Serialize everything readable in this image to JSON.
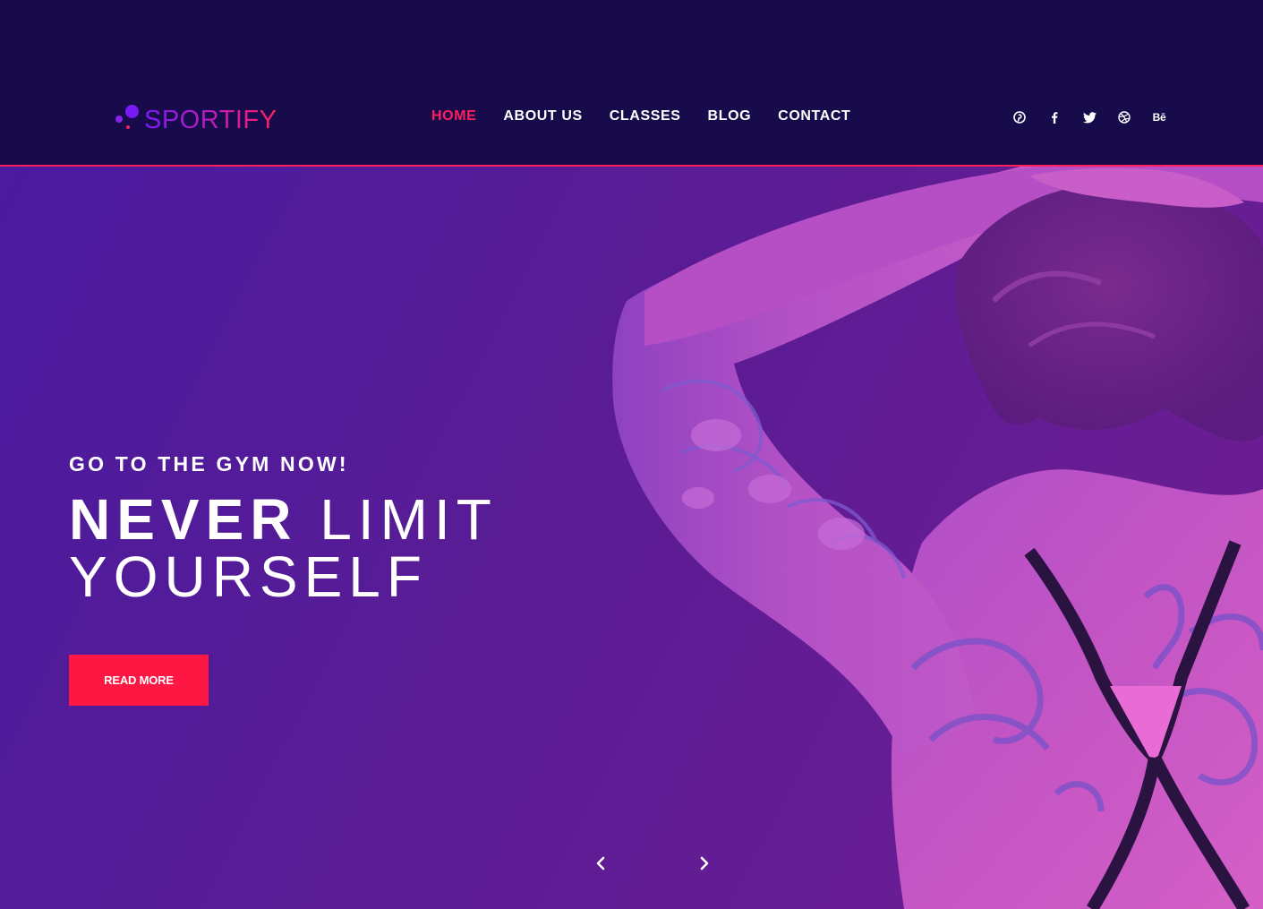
{
  "brand": {
    "name": "SPORTIFY"
  },
  "nav": {
    "items": [
      {
        "label": "HOME",
        "active": true
      },
      {
        "label": "ABOUT US",
        "active": false
      },
      {
        "label": "CLASSES",
        "active": false
      },
      {
        "label": "BLOG",
        "active": false
      },
      {
        "label": "CONTACT",
        "active": false
      }
    ]
  },
  "social": {
    "icons": [
      "pinterest-icon",
      "facebook-icon",
      "twitter-icon",
      "dribbble-icon",
      "behance-icon"
    ],
    "behance_text": "Bē"
  },
  "hero": {
    "kicker": "GO TO THE GYM NOW!",
    "headline_strong": "NEVER",
    "headline_light_1": "LIMIT",
    "headline_light_2": "YOURSELF",
    "cta_label": "READ MORE",
    "prev_icon": "chevron-left-icon",
    "next_icon": "chevron-right-icon"
  },
  "colors": {
    "header_bg": "#170b4c",
    "accent": "#ff1f5a",
    "hero_purple": "#5a1c96",
    "button": "#ff1744",
    "text": "#ffffff"
  }
}
